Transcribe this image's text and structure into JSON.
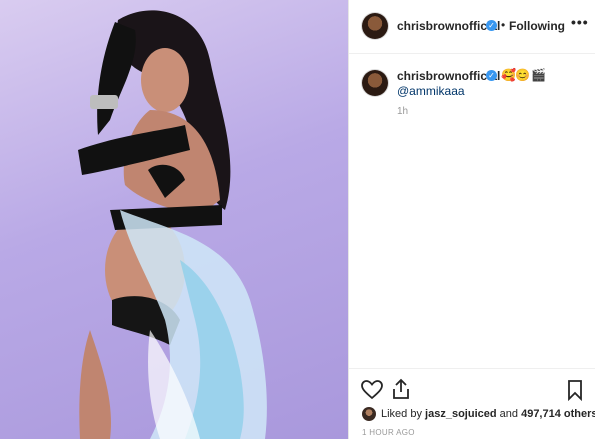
{
  "post": {
    "header": {
      "username": "chrisbrownofficial",
      "separator": "•",
      "follow_status": "Following",
      "more_label": "•••"
    },
    "caption": {
      "username": "chrisbrownofficial",
      "emojis": [
        "🥰",
        "😊",
        "🎬"
      ],
      "mention": "@ammikaaa",
      "time": "1h"
    },
    "footer": {
      "liked_by_prefix": "Liked by",
      "liked_by_user": "jasz_sojuiced",
      "and_text": "and",
      "others_count": "497,714 others",
      "posted_ago": "1 HOUR AGO"
    },
    "icons": {
      "verified": "verified-badge-icon",
      "like": "heart-icon",
      "share": "share-icon",
      "save": "bookmark-icon",
      "more": "more-options-icon"
    },
    "colors": {
      "verified_blue": "#3897f0",
      "mention_blue": "#003569",
      "muted_gray": "#999999",
      "background_lavender": "#b9a9e6"
    }
  }
}
